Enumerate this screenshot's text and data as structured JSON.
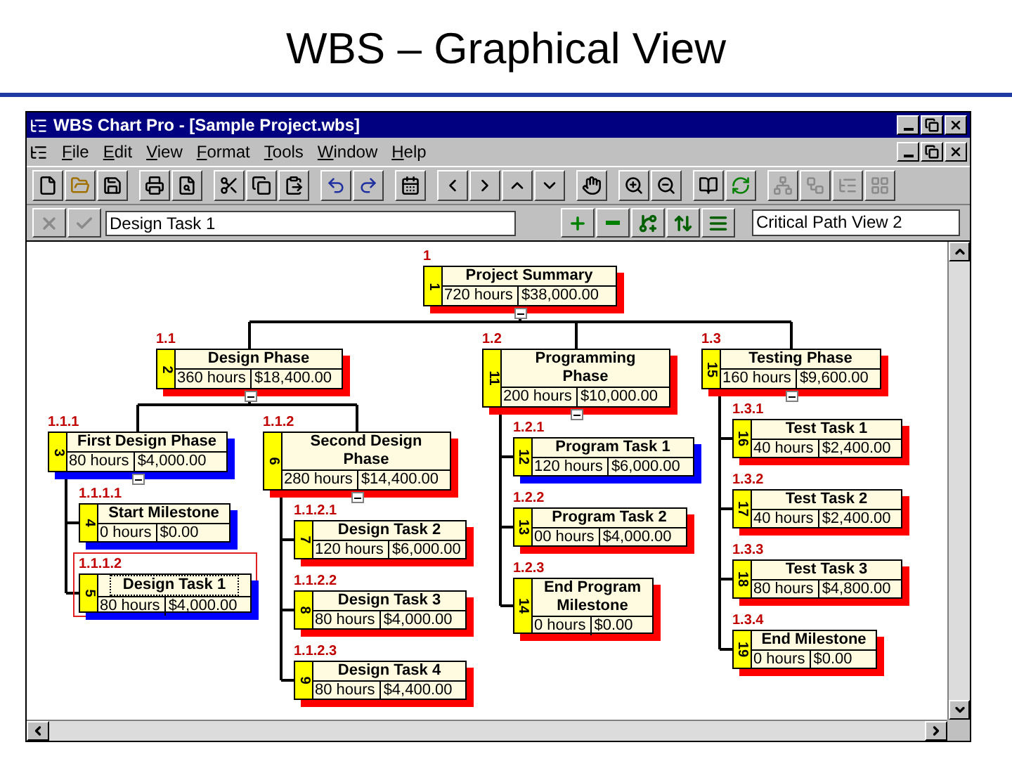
{
  "slide_title": "WBS – Graphical View",
  "window": {
    "title": "WBS Chart Pro - [Sample Project.wbs]"
  },
  "menu": [
    "File",
    "Edit",
    "View",
    "Format",
    "Tools",
    "Window",
    "Help"
  ],
  "toolbar": [
    {
      "disabled": false
    },
    {
      "disabled": false
    },
    {
      "disabled": false
    },
    {
      "disabled": false
    },
    {
      "disabled": false
    },
    {
      "disabled": false
    },
    {
      "disabled": false
    },
    {
      "disabled": false
    },
    {
      "disabled": false
    },
    {
      "disabled": false
    },
    {
      "disabled": false
    },
    {
      "disabled": false
    },
    {
      "disabled": false
    },
    {
      "disabled": false
    },
    {
      "disabled": false
    },
    {
      "disabled": false
    },
    {
      "disabled": false
    },
    {
      "disabled": false
    },
    {
      "disabled": false
    },
    {
      "disabled": false
    },
    {
      "disabled": true
    },
    {
      "disabled": true
    },
    {
      "disabled": true
    },
    {
      "disabled": true
    }
  ],
  "edit_toolbar": {
    "buttons": [
      {
        "disabled": true
      },
      {
        "disabled": true
      },
      {
        "disabled": false
      },
      {
        "disabled": false
      },
      {
        "disabled": false
      },
      {
        "disabled": false
      },
      {
        "disabled": false
      }
    ],
    "task_name": "Design Task 1",
    "view": "Critical Path View 2"
  },
  "wbs": {
    "code": "1",
    "number": "1",
    "title": "Project Summary",
    "hours": "720 hours",
    "cost": "$38,000.00",
    "color": "#ff0000",
    "selected": false,
    "children": [
      {
        "code": "1.1",
        "number": "2",
        "title": "Design Phase",
        "hours": "360 hours",
        "cost": "$18,400.00",
        "color": "#ff0000",
        "selected": false,
        "children": [
          {
            "code": "1.1.1",
            "number": "3",
            "title": "First Design Phase",
            "hours": "80 hours",
            "cost": "$4,000.00",
            "color": "#0000ff",
            "selected": false,
            "children": [
              {
                "code": "1.1.1.1",
                "number": "4",
                "title": "Start Milestone",
                "hours": "0 hours",
                "cost": "$0.00",
                "color": "#0000ff",
                "selected": false
              },
              {
                "code": "1.1.1.2",
                "number": "5",
                "title": "Design Task 1",
                "hours": "80 hours",
                "cost": "$4,000.00",
                "color": "#0000ff",
                "selected": true
              }
            ]
          },
          {
            "code": "1.1.2",
            "number": "6",
            "title": "Second Design Phase",
            "hours": "280 hours",
            "cost": "$14,400.00",
            "color": "#ff0000",
            "selected": false,
            "children": [
              {
                "code": "1.1.2.1",
                "number": "7",
                "title": "Design Task 2",
                "hours": "120 hours",
                "cost": "$6,000.00",
                "color": "#ff0000",
                "selected": false
              },
              {
                "code": "1.1.2.2",
                "number": "8",
                "title": "Design Task 3",
                "hours": "80 hours",
                "cost": "$4,000.00",
                "color": "#ff0000",
                "selected": false
              },
              {
                "code": "1.1.2.3",
                "number": "9",
                "title": "Design Task 4",
                "hours": "80 hours",
                "cost": "$4,400.00",
                "color": "#ff0000",
                "selected": false
              }
            ]
          }
        ]
      },
      {
        "code": "1.2",
        "number": "11",
        "title": "Programming Phase",
        "hours": "200 hours",
        "cost": "$10,000.00",
        "color": "#ff0000",
        "selected": false,
        "children": [
          {
            "code": "1.2.1",
            "number": "12",
            "title": "Program Task 1",
            "hours": "120 hours",
            "cost": "$6,000.00",
            "color": "#0000ff",
            "selected": false
          },
          {
            "code": "1.2.2",
            "number": "13",
            "title": "Program Task 2",
            "hours": "00 hours",
            "cost": "$4,000.00",
            "color": "#ff0000",
            "selected": false
          },
          {
            "code": "1.2.3",
            "number": "14",
            "title": "End Program Milestone",
            "hours": "0 hours",
            "cost": "$0.00",
            "color": "#ff0000",
            "selected": false
          }
        ]
      },
      {
        "code": "1.3",
        "number": "15",
        "title": "Testing Phase",
        "hours": "160 hours",
        "cost": "$9,600.00",
        "color": "#ff0000",
        "selected": false,
        "children": [
          {
            "code": "1.3.1",
            "number": "16",
            "title": "Test Task 1",
            "hours": "40 hours",
            "cost": "$2,400.00",
            "color": "#ff0000",
            "selected": false
          },
          {
            "code": "1.3.2",
            "number": "17",
            "title": "Test Task 2",
            "hours": "40 hours",
            "cost": "$2,400.00",
            "color": "#ff0000",
            "selected": false
          },
          {
            "code": "1.3.3",
            "number": "18",
            "title": "Test Task 3",
            "hours": "80 hours",
            "cost": "$4,800.00",
            "color": "#ff0000",
            "selected": false
          },
          {
            "code": "1.3.4",
            "number": "19",
            "title": "End Milestone",
            "hours": "0 hours",
            "cost": "$0.00",
            "color": "#ff0000",
            "selected": false
          }
        ]
      }
    ]
  }
}
